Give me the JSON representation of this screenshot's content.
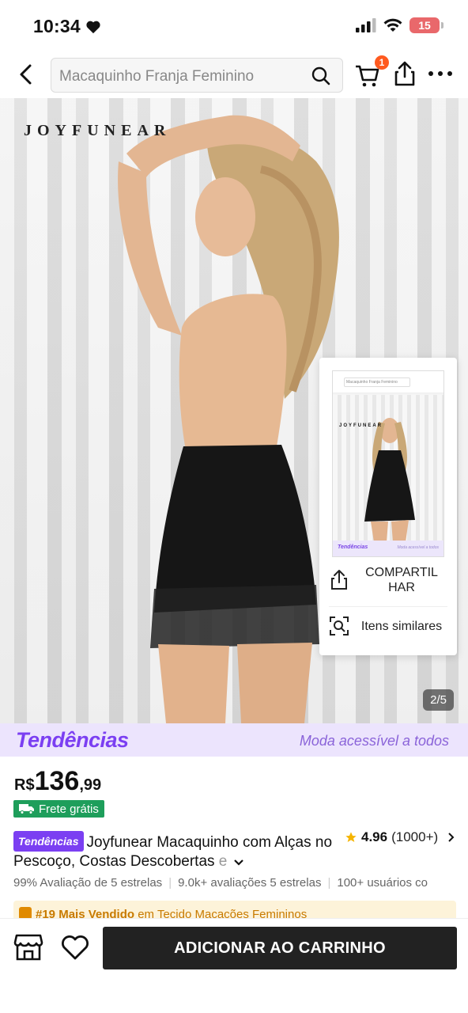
{
  "status": {
    "time": "10:34",
    "battery": "15"
  },
  "header": {
    "search_placeholder": "Macaquinho Franja Feminino",
    "cart_count": "1"
  },
  "product_image": {
    "brand": "JOYFUNEAR",
    "counter": "2/5"
  },
  "share_popup": {
    "share_label": "COMPARTIL HAR",
    "similar_label": "Itens similares",
    "thumb_brand": "JOYFUNEAR",
    "thumb_search": "Macaquinho Franja Feminino",
    "thumb_tag": "Tendências",
    "thumb_tag_right": "Moda acessível a todos"
  },
  "trend_banner": {
    "logo": "Tendências",
    "slogan": "Moda acessível a todos"
  },
  "price": {
    "currency": "R$",
    "integer": "136",
    "decimal": ",99"
  },
  "shipping": {
    "label": "Frete grátis"
  },
  "title": {
    "badge": "Tendências",
    "text": "Joyfunear Macaquinho com Alças no Pescoço, Costas Descobertas ",
    "fade": "e"
  },
  "rating": {
    "value": "4.96",
    "count": "(1000+)"
  },
  "stats": {
    "a": "99% Avaliação de 5 estrelas",
    "b": "9.0k+ avaliações 5 estrelas",
    "c": "100+ usuários co"
  },
  "best_seller": {
    "rank": "#19 Mais Vendido",
    "category": "em Tecido Macacões Femininos"
  },
  "bottom": {
    "add_to_cart": "ADICIONAR AO CARRINHO"
  }
}
